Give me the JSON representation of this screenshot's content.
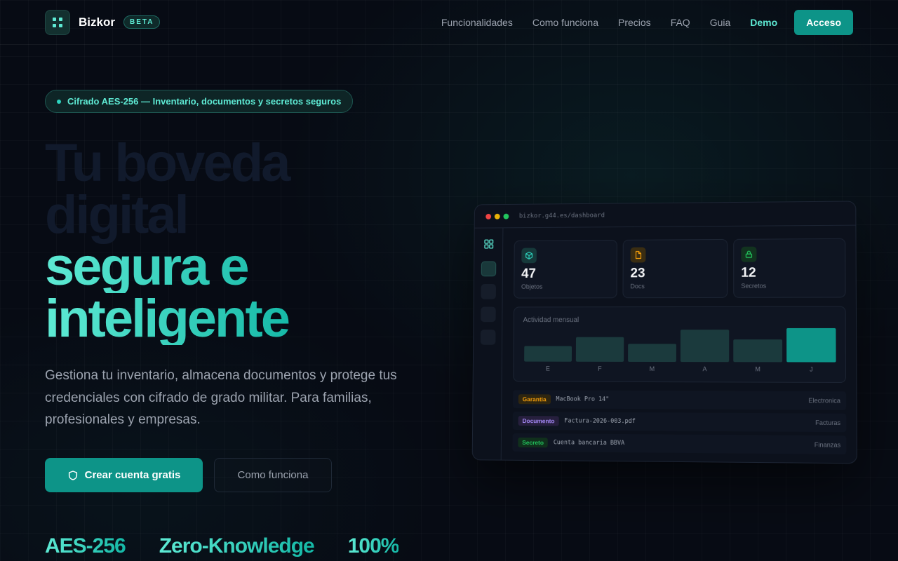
{
  "nav": {
    "brand": "Bizkor",
    "badge": "BETA",
    "links": [
      "Funcionalidades",
      "Como funciona",
      "Precios",
      "FAQ",
      "Guia",
      "Demo"
    ],
    "cta": "Acceso"
  },
  "hero": {
    "pill": "Cifrado AES-256 — Inventario, documentos y secretos seguros",
    "title_line1": "Tu boveda",
    "title_line2": "digital",
    "title_line3": "segura e",
    "title_line4": "inteligente",
    "subtitle": "Gestiona tu inventario, almacena documentos y protege tus credenciales con cifrado de grado militar. Para familias, profesionales y empresas.",
    "primary_cta": "Crear cuenta gratis",
    "secondary_cta": "Como funciona",
    "stats": [
      "AES-256",
      "Zero-Knowledge",
      "100%"
    ]
  },
  "dashboard": {
    "url": "bizkor.g44.es/dashboard",
    "cards": [
      {
        "value": "47",
        "label": "Objetos",
        "icon": "cube-icon",
        "color": "#2dd4bf"
      },
      {
        "value": "23",
        "label": "Docs",
        "icon": "document-icon",
        "color": "#f59e0b"
      },
      {
        "value": "12",
        "label": "Secretos",
        "icon": "lock-icon",
        "color": "#22c55e"
      }
    ],
    "rows": [
      {
        "tag": "Garantia",
        "name": "MacBook Pro 14\"",
        "category": "Electronica",
        "tag_color": "#f59e0b"
      },
      {
        "tag": "Documento",
        "name": "Factura-2026-003.pdf",
        "category": "Facturas",
        "tag_color": "#a78bfa"
      },
      {
        "tag": "Secreto",
        "name": "Cuenta bancaria BBVA",
        "category": "Finanzas",
        "tag_color": "#22c55e"
      }
    ]
  },
  "chart_data": {
    "type": "bar",
    "title": "Actividad mensual",
    "categories": [
      "E",
      "F",
      "M",
      "A",
      "M",
      "J"
    ],
    "values": [
      42,
      66,
      48,
      86,
      60,
      90
    ],
    "highlight_last": true,
    "colors": {
      "bar": "#1b3a3d",
      "highlight": "#0d9488"
    }
  },
  "colors": {
    "accent": "#0d9488",
    "accent_light": "#5eead4",
    "background": "#070b14"
  }
}
